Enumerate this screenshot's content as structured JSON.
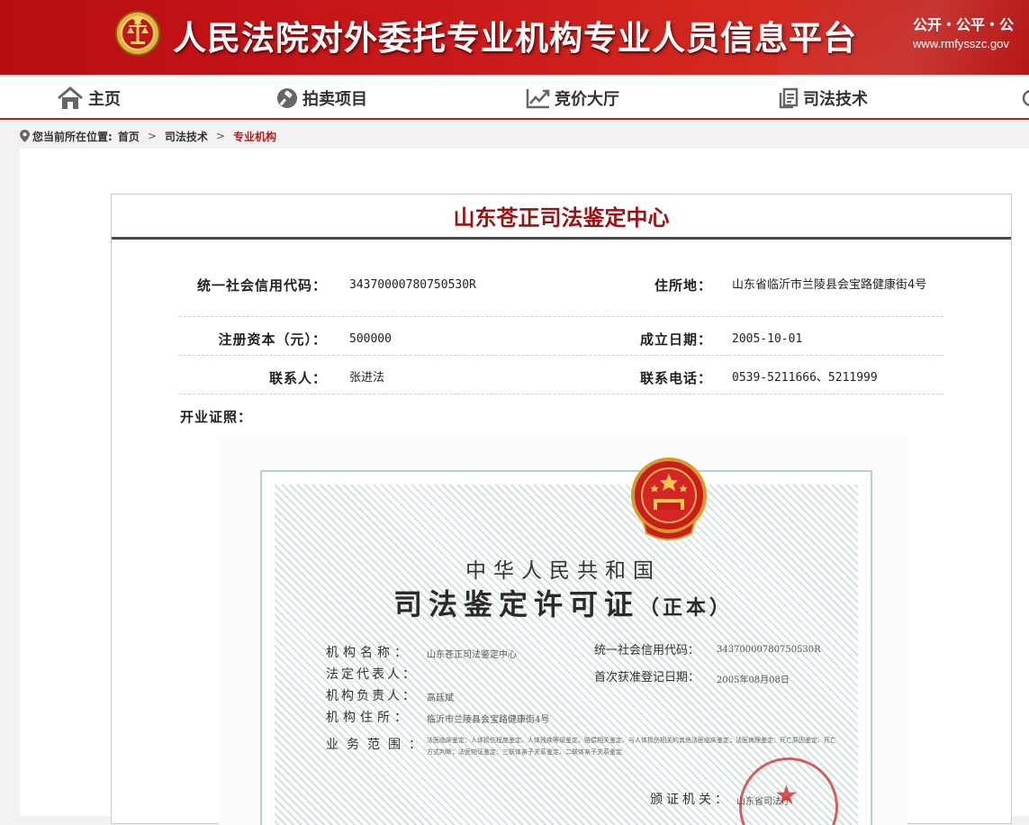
{
  "header": {
    "site_title": "人民法院对外委托专业机构专业人员信息平台",
    "slogan": "公开・公平・公",
    "url": "www.rmfysszc.gov"
  },
  "nav": [
    {
      "label": "主页",
      "icon": "home-icon"
    },
    {
      "label": "拍卖项目",
      "icon": "gavel-icon"
    },
    {
      "label": "竞价大厅",
      "icon": "trend-chart-icon"
    },
    {
      "label": "司法技术",
      "icon": "document-icon"
    }
  ],
  "breadcrumb": {
    "prefix": "您当前所在位置:",
    "items": [
      "首页",
      "司法技术",
      "专业机构"
    ],
    "separator": ">"
  },
  "institution": {
    "name": "山东苍正司法鉴定中心",
    "credit_code_label": "统一社会信用代码：",
    "credit_code": "34370000780750530R",
    "address_label": "住所地：",
    "address": "山东省临沂市兰陵县会宝路健康街4号",
    "capital_label": "注册资本（元）：",
    "capital": "500000",
    "founded_label": "成立日期：",
    "founded": "2005-10-01",
    "contact_label": "联系人：",
    "contact": "张进法",
    "phone_label": "联系电话：",
    "phone": "0539-5211666、5211999",
    "license_label": "开业证照："
  },
  "certificate": {
    "country": "中华人民共和国",
    "title": "司法鉴定许可证",
    "title_suffix": "（正本）",
    "fields": {
      "org_name_label": "机构名称：",
      "org_name": "山东苍正司法鉴定中心",
      "legal_rep_label": "法定代表人：",
      "head_label": "机构负责人：",
      "head": "高廷斌",
      "address_label": "机构住所：",
      "address": "临沂市兰陵县会宝路健康街4号",
      "scope_label": "业务范围：",
      "scope": "法医临床鉴定：人体损伤程度鉴定、人体残疾等级鉴定、赔偿相关鉴定、与人体损伤相关的其他法医临床鉴定；法医病理鉴定：死亡原因鉴定、死亡方式判断；法医物证鉴定：三联体亲子关系鉴定、二联体亲子关系鉴定",
      "credit_label": "统一社会信用代码：",
      "credit": "34370000780750530R",
      "first_reg_label": "首次获准登记日期：",
      "first_reg": "2005年08月08日",
      "issuer_label": "颁证机关：",
      "issuer": "山东省司法厅"
    }
  }
}
